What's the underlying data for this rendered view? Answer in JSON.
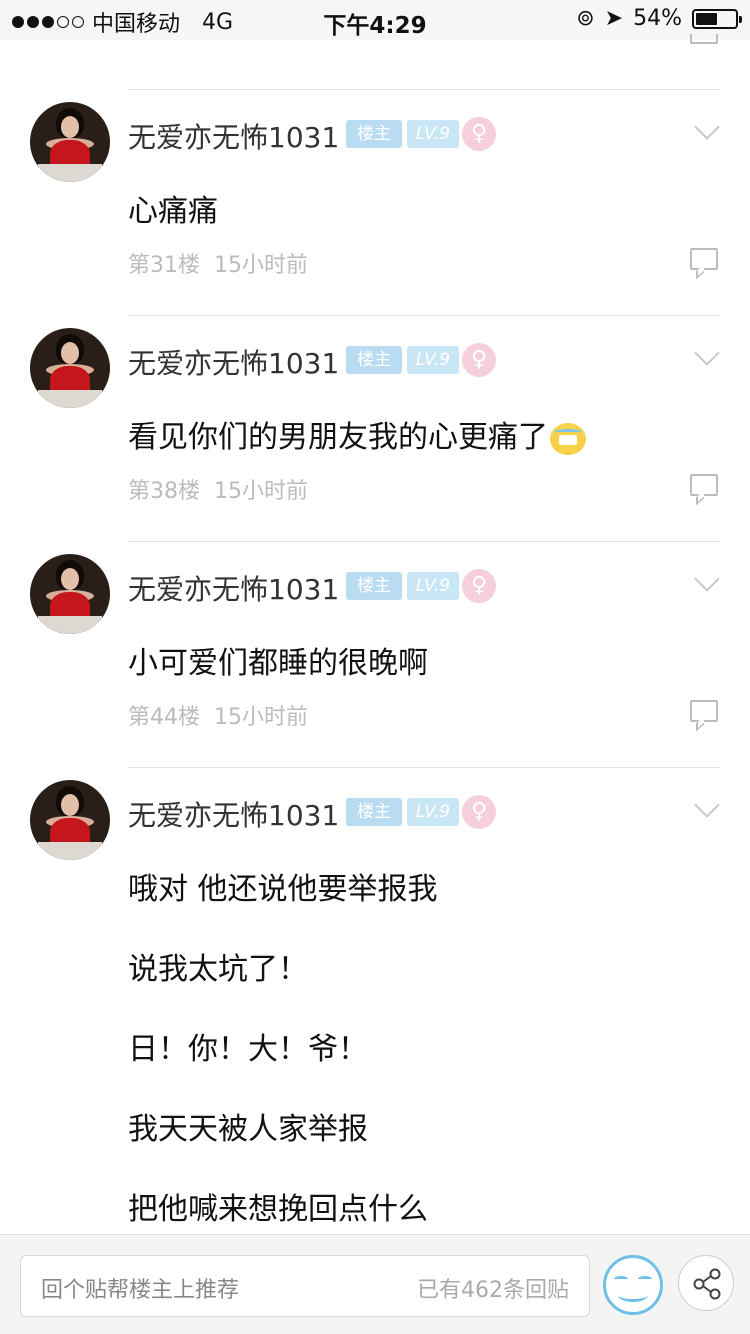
{
  "status_bar": {
    "carrier": "中国移动",
    "network": "4G",
    "time": "下午4:29",
    "battery": "54%",
    "battery_level": 0.54
  },
  "posts": [
    {
      "username": "无爱亦无怖1031",
      "owner_badge": "楼主",
      "level_badge": "LV.9",
      "gender_icon": "female-icon",
      "content": [
        "心痛痛"
      ],
      "floor": "第31楼",
      "time": "15小时前"
    },
    {
      "username": "无爱亦无怖1031",
      "owner_badge": "楼主",
      "level_badge": "LV.9",
      "gender_icon": "female-icon",
      "content": [
        "看见你们的男朋友我的心更痛了"
      ],
      "has_emoji": true,
      "floor": "第38楼",
      "time": "15小时前"
    },
    {
      "username": "无爱亦无怖1031",
      "owner_badge": "楼主",
      "level_badge": "LV.9",
      "gender_icon": "female-icon",
      "content": [
        "小可爱们都睡的很晚啊"
      ],
      "floor": "第44楼",
      "time": "15小时前"
    },
    {
      "username": "无爱亦无怖1031",
      "owner_badge": "楼主",
      "level_badge": "LV.9",
      "gender_icon": "female-icon",
      "content": [
        "哦对 他还说他要举报我",
        "说我太坑了！",
        "日！你！大！爷！",
        "我天天被人家举报",
        "把他喊来想挽回点什么"
      ]
    }
  ],
  "bottom_bar": {
    "placeholder": "回个贴帮楼主上推荐",
    "reply_count": "已有462条回贴"
  },
  "colors": {
    "badge_owner": "#b9dcf2",
    "badge_level": "#c8e6f5",
    "badge_gender": "#f6cfdc",
    "emoji_accent": "#6fc0e8"
  }
}
